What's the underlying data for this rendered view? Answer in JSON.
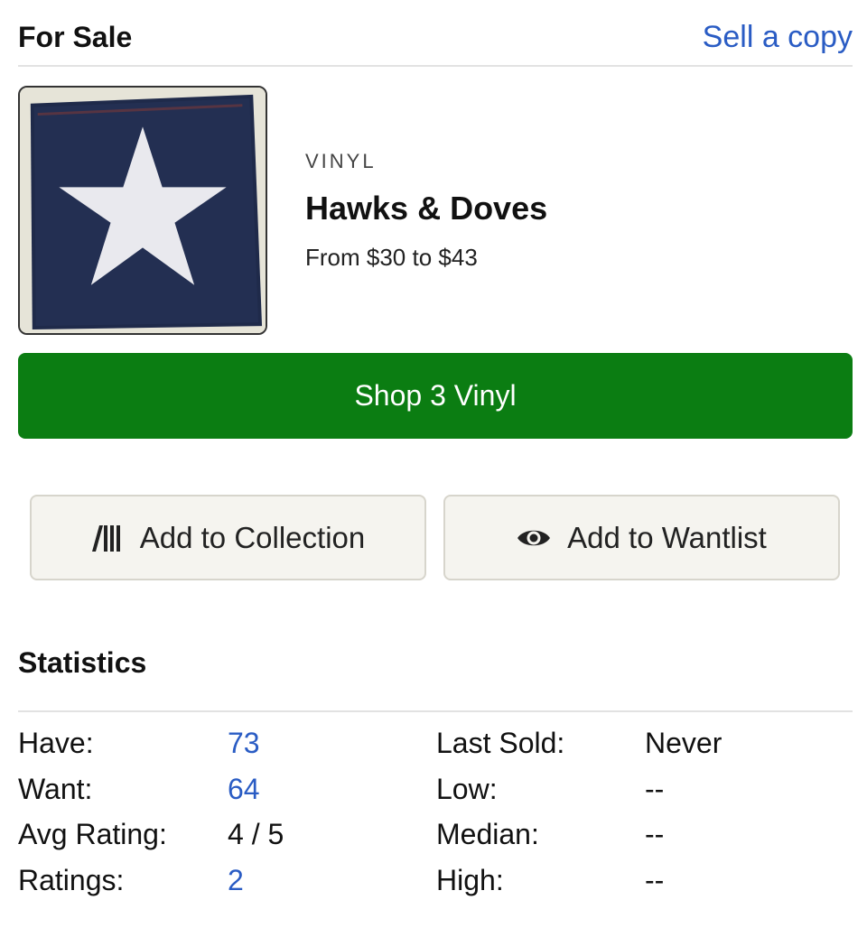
{
  "header": {
    "title": "For Sale",
    "sell_link": "Sell a copy"
  },
  "release": {
    "format": "VINYL",
    "title": "Hawks & Doves",
    "price_range": "From $30 to $43",
    "cover_image": "album-cover-white-star-on-navy"
  },
  "shop_button": {
    "label": "Shop 3 Vinyl",
    "color": "#0b7d12"
  },
  "actions": {
    "collection": {
      "label": "Add to Collection",
      "icon": "collection-shelf-icon"
    },
    "wantlist": {
      "label": "Add to Wantlist",
      "icon": "eye-icon"
    }
  },
  "statistics": {
    "title": "Statistics",
    "rows": [
      {
        "label": "Have:",
        "value": "73",
        "right_label": "Last Sold:",
        "right_value": "Never"
      },
      {
        "label": "Want:",
        "value": "64",
        "right_label": "Low:",
        "right_value": "--"
      },
      {
        "label": "Avg Rating:",
        "value": "4 / 5",
        "right_label": "Median:",
        "right_value": "--"
      },
      {
        "label": "Ratings:",
        "value": "2",
        "right_label": "High:",
        "right_value": "--"
      }
    ]
  },
  "colors": {
    "link": "#2a5cc4",
    "divider": "#e2e2e2",
    "button_bg": "#f5f4ef"
  }
}
